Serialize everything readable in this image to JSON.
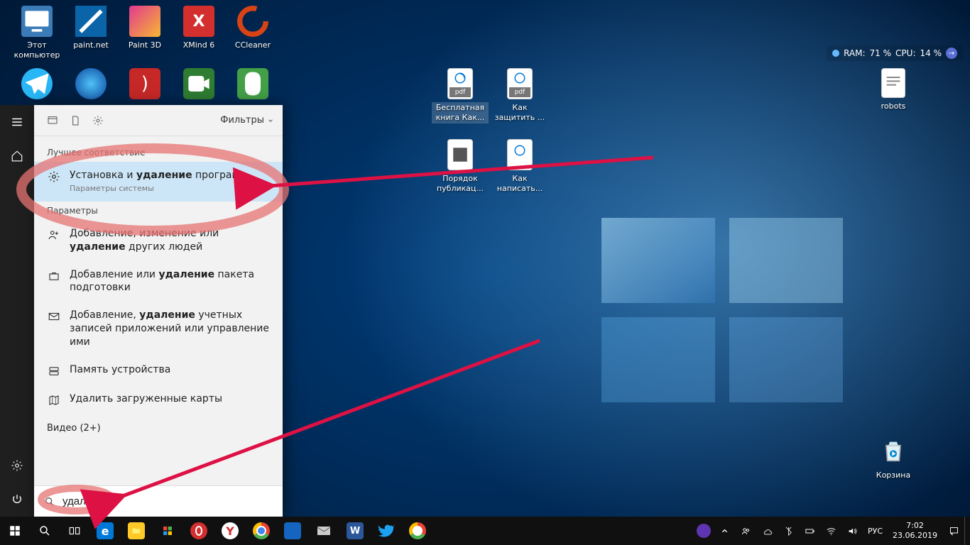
{
  "desktop": {
    "icons_row1": [
      {
        "label": "Этот\nкомпьютер",
        "color": "#3a7bb8"
      },
      {
        "label": "paint.net",
        "color": "#0b64a8"
      },
      {
        "label": "Paint 3D",
        "color": "#e23a8e"
      },
      {
        "label": "XMind 6",
        "color": "#d32f2f"
      },
      {
        "label": "CCleaner",
        "color": "#d84315"
      }
    ],
    "icons_row2": [
      {
        "label": "",
        "color": "#29b6f6"
      },
      {
        "label": "",
        "color": "#1565c0"
      },
      {
        "label": "",
        "color": "#c62828"
      },
      {
        "label": "",
        "color": "#2e7d32"
      },
      {
        "label": "",
        "color": "#43a047"
      }
    ],
    "icons_mid": [
      {
        "label": "Бесплатная книга Как...",
        "sub": "pdf"
      },
      {
        "label": "Как защитить ...",
        "sub": "pdf"
      },
      {
        "label": "Порядок публикац...",
        "sub": ""
      },
      {
        "label": "Как написать...",
        "sub": ""
      }
    ],
    "robots_label": "robots",
    "bin_label": "Корзина"
  },
  "perf": {
    "ram_label": "RAM:",
    "ram_val": "71 %",
    "cpu_label": "CPU:",
    "cpu_val": "14 %"
  },
  "search": {
    "filters_label": "Фильтры",
    "best_match": "Лучшее соответствие",
    "best_item": {
      "pre": "Установка и ",
      "bold": "удаление",
      "post": " программ",
      "sub": "Параметры системы"
    },
    "section_params": "Параметры",
    "items": [
      {
        "pre": "Добавление, изменение или ",
        "bold": "удаление",
        "post": " других людей"
      },
      {
        "pre": "Добавление или ",
        "bold": "удаление",
        "post": " пакета подготовки"
      },
      {
        "pre": "Добавление, ",
        "bold": "удаление",
        "post": " учетных записей приложений или управление ими"
      },
      {
        "pre": "",
        "bold": "",
        "post": "Память устройства"
      },
      {
        "pre": "",
        "bold": "",
        "post": "Удалить загруженные карты"
      }
    ],
    "video_label": "Видео (2+)",
    "query": "удаление"
  },
  "taskbar": {
    "lang": "РУС",
    "time": "7:02",
    "date": "23.06.2019"
  }
}
